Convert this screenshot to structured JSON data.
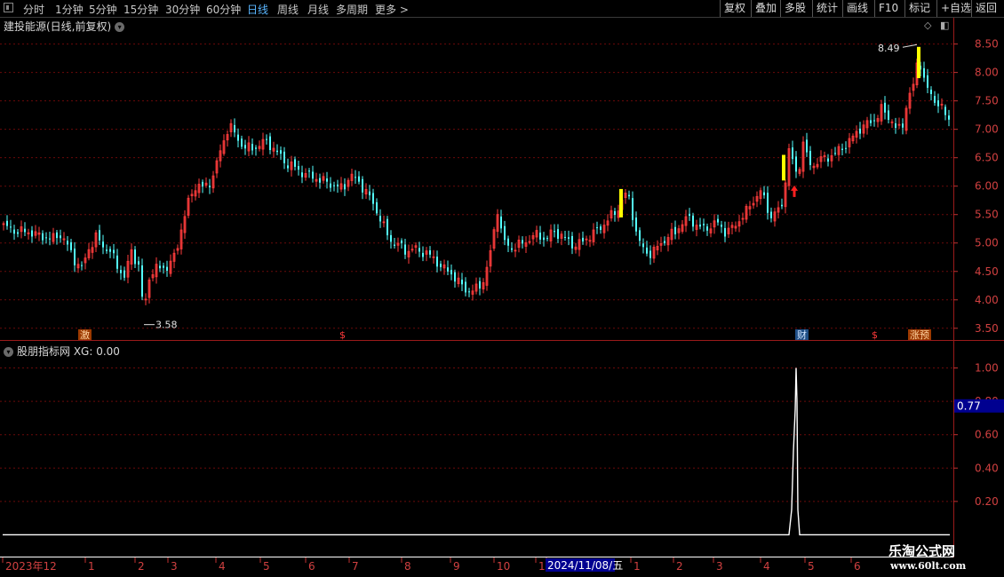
{
  "toolbar": {
    "tabs": [
      "分时",
      "1分钟",
      "5分钟",
      "15分钟",
      "30分钟",
      "60分钟",
      "日线",
      "周线",
      "月线",
      "多周期",
      "更多 >"
    ],
    "active_tab": "日线",
    "right_buttons": [
      "复权",
      "叠加",
      "多股",
      "统计",
      "画线",
      "F10",
      "标记",
      "+自选",
      "返回"
    ]
  },
  "stock": {
    "title": "建投能源(日线,前复权)"
  },
  "indicator": {
    "title": "股朋指标网 XG: 0.00",
    "cursor_value": "0.77"
  },
  "annotations": {
    "high_label": "8.49",
    "low_label": "3.58"
  },
  "badges": {
    "ji": "激",
    "s1": "$",
    "cai": "财",
    "s2": "$",
    "zhang": "涨预"
  },
  "watermark": {
    "title": "乐淘公式网",
    "url": "www.60lt.com"
  },
  "colors": {
    "up": "#ff3c3c",
    "down": "#54ffff",
    "grid": "#6b0a0a",
    "highlight": "#ffff00",
    "signal": "#ffffff",
    "cursor_box": "#000090"
  },
  "chart_data": [
    {
      "type": "candlestick",
      "title": "建投能源(日线,前复权)",
      "y_ticks": [
        "8.50",
        "8.00",
        "7.50",
        "7.00",
        "6.50",
        "6.00",
        "5.50",
        "5.00",
        "4.50",
        "4.00",
        "3.50"
      ],
      "ylim": [
        3.45,
        8.65
      ],
      "x_ticks": [
        "2023年12",
        "1",
        "2",
        "3",
        "4",
        "5",
        "6",
        "7",
        "8",
        "9",
        "10",
        "11",
        "2024/11/08/五",
        "1",
        "2",
        "3",
        "4",
        "5",
        "6"
      ],
      "high": 8.49,
      "low": 3.58,
      "close_path": [
        [
          0,
          5.3
        ],
        [
          8,
          5.25
        ],
        [
          16,
          5.2
        ],
        [
          24,
          5.2
        ],
        [
          32,
          5.18
        ],
        [
          40,
          5.12
        ],
        [
          48,
          5.1
        ],
        [
          56,
          5.08
        ],
        [
          64,
          5.15
        ],
        [
          72,
          4.95
        ],
        [
          80,
          4.7
        ],
        [
          88,
          4.55
        ],
        [
          96,
          4.9
        ],
        [
          104,
          5.1
        ],
        [
          112,
          4.95
        ],
        [
          120,
          4.85
        ],
        [
          128,
          4.6
        ],
        [
          136,
          4.4
        ],
        [
          144,
          4.85
        ],
        [
          152,
          4.6
        ],
        [
          158,
          3.75
        ],
        [
          164,
          4.4
        ],
        [
          170,
          4.55
        ],
        [
          178,
          4.55
        ],
        [
          186,
          4.6
        ],
        [
          194,
          4.8
        ],
        [
          202,
          5.4
        ],
        [
          210,
          5.8
        ],
        [
          218,
          6.05
        ],
        [
          226,
          5.95
        ],
        [
          234,
          6.1
        ],
        [
          242,
          6.5
        ],
        [
          248,
          6.8
        ],
        [
          254,
          7.1
        ],
        [
          262,
          6.85
        ],
        [
          270,
          6.7
        ],
        [
          278,
          6.65
        ],
        [
          286,
          6.7
        ],
        [
          294,
          6.8
        ],
        [
          302,
          6.7
        ],
        [
          310,
          6.55
        ],
        [
          318,
          6.4
        ],
        [
          326,
          6.35
        ],
        [
          334,
          6.25
        ],
        [
          342,
          6.2
        ],
        [
          350,
          6.15
        ],
        [
          358,
          6.1
        ],
        [
          366,
          6.05
        ],
        [
          374,
          6.0
        ],
        [
          382,
          5.95
        ],
        [
          390,
          6.2
        ],
        [
          398,
          6.1
        ],
        [
          406,
          5.95
        ],
        [
          414,
          5.75
        ],
        [
          422,
          5.5
        ],
        [
          430,
          5.2
        ],
        [
          438,
          5.0
        ],
        [
          446,
          4.95
        ],
        [
          454,
          4.85
        ],
        [
          462,
          4.9
        ],
        [
          470,
          4.85
        ],
        [
          478,
          4.8
        ],
        [
          486,
          4.7
        ],
        [
          494,
          4.55
        ],
        [
          502,
          4.5
        ],
        [
          510,
          4.35
        ],
        [
          518,
          4.2
        ],
        [
          526,
          4.15
        ],
        [
          534,
          4.2
        ],
        [
          540,
          4.35
        ],
        [
          546,
          4.65
        ],
        [
          552,
          5.2
        ],
        [
          556,
          5.6
        ],
        [
          562,
          5.05
        ],
        [
          570,
          4.9
        ],
        [
          578,
          4.95
        ],
        [
          586,
          5.0
        ],
        [
          594,
          5.1
        ],
        [
          602,
          5.15
        ],
        [
          610,
          5.05
        ],
        [
          618,
          5.2
        ],
        [
          626,
          5.15
        ],
        [
          634,
          5.05
        ],
        [
          642,
          4.95
        ],
        [
          650,
          5.0
        ],
        [
          658,
          5.1
        ],
        [
          666,
          5.2
        ],
        [
          674,
          5.3
        ],
        [
          682,
          5.45
        ],
        [
          690,
          5.55
        ],
        [
          696,
          5.75
        ],
        [
          702,
          5.9
        ],
        [
          708,
          5.5
        ],
        [
          714,
          5.05
        ],
        [
          720,
          4.9
        ],
        [
          726,
          4.8
        ],
        [
          732,
          4.85
        ],
        [
          740,
          5.0
        ],
        [
          748,
          5.1
        ],
        [
          756,
          5.2
        ],
        [
          764,
          5.35
        ],
        [
          772,
          5.45
        ],
        [
          780,
          5.3
        ],
        [
          788,
          5.25
        ],
        [
          796,
          5.3
        ],
        [
          804,
          5.35
        ],
        [
          812,
          5.2
        ],
        [
          820,
          5.25
        ],
        [
          828,
          5.4
        ],
        [
          836,
          5.55
        ],
        [
          844,
          5.75
        ],
        [
          852,
          5.9
        ],
        [
          858,
          5.7
        ],
        [
          864,
          5.45
        ],
        [
          870,
          5.55
        ],
        [
          876,
          5.65
        ],
        [
          880,
          6.15
        ],
        [
          884,
          6.6
        ],
        [
          888,
          6.45
        ],
        [
          892,
          6.25
        ],
        [
          896,
          6.35
        ],
        [
          900,
          6.8
        ],
        [
          904,
          6.5
        ],
        [
          910,
          6.35
        ],
        [
          918,
          6.45
        ],
        [
          926,
          6.5
        ],
        [
          934,
          6.55
        ],
        [
          942,
          6.65
        ],
        [
          950,
          6.75
        ],
        [
          958,
          6.9
        ],
        [
          966,
          7.05
        ],
        [
          974,
          7.1
        ],
        [
          982,
          7.2
        ],
        [
          988,
          7.35
        ],
        [
          994,
          7.25
        ],
        [
          1000,
          7.15
        ],
        [
          1006,
          6.95
        ],
        [
          1012,
          7.1
        ],
        [
          1018,
          7.55
        ],
        [
          1024,
          7.75
        ],
        [
          1030,
          8.35
        ],
        [
          1034,
          7.95
        ],
        [
          1040,
          7.7
        ],
        [
          1046,
          7.55
        ],
        [
          1052,
          7.45
        ],
        [
          1058,
          7.3
        ],
        [
          1066,
          7.15
        ]
      ]
    },
    {
      "type": "line",
      "title": "股朋指标网 XG: 0.00",
      "y_ticks": [
        "1.00",
        "0.80",
        "0.60",
        "0.40",
        "0.20"
      ],
      "ylim": [
        -0.12,
        1.04
      ],
      "series": [
        {
          "values": [
            [
              0,
              0
            ],
            [
              885,
              0
            ],
            [
              888,
              0.15
            ],
            [
              890,
              0.5
            ],
            [
              892,
              0.75
            ],
            [
              893,
              1.0
            ],
            [
              894,
              0.8
            ],
            [
              895,
              0.15
            ],
            [
              897,
              0
            ],
            [
              1066,
              0
            ]
          ]
        }
      ]
    }
  ]
}
